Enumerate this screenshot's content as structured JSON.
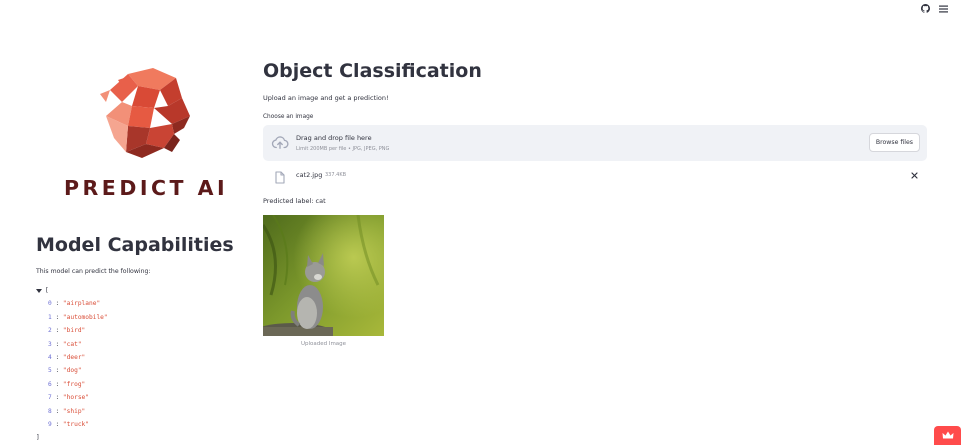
{
  "toolbar": {
    "github_icon": "github-icon",
    "menu_icon": "hamburger-menu-icon"
  },
  "sidebar": {
    "logo_icon": "polygonal-head-logo",
    "brand": "PREDICT AI",
    "title": "Model Capabilities",
    "description": "This model can predict the following:",
    "json_open": "[",
    "json_close": "]",
    "classes": [
      {
        "index": "0",
        "value": "\"airplane\""
      },
      {
        "index": "1",
        "value": "\"automobile\""
      },
      {
        "index": "2",
        "value": "\"bird\""
      },
      {
        "index": "3",
        "value": "\"cat\""
      },
      {
        "index": "4",
        "value": "\"deer\""
      },
      {
        "index": "5",
        "value": "\"dog\""
      },
      {
        "index": "6",
        "value": "\"frog\""
      },
      {
        "index": "7",
        "value": "\"horse\""
      },
      {
        "index": "8",
        "value": "\"ship\""
      },
      {
        "index": "9",
        "value": "\"truck\""
      }
    ]
  },
  "main": {
    "title": "Object Classification",
    "intro": "Upload an image and get a prediction!",
    "uploader_label": "Choose an image",
    "dropzone": {
      "icon": "cloud-upload-icon",
      "main_text": "Drag and drop file here",
      "sub_text": "Limit 200MB per file • JPG, JPEG, PNG",
      "button_label": "Browse files"
    },
    "file": {
      "icon": "file-icon",
      "name": "cat2.jpg",
      "size": "337.4KB",
      "remove_icon": "close-icon"
    },
    "prediction": "Predicted label: cat",
    "image_caption": "Uploaded Image"
  },
  "colors": {
    "accent": "#ff4b4b",
    "brand": "#5c1a1a",
    "logo": "#e8604a",
    "text": "#31333f",
    "dropzone_bg": "#f0f2f6"
  }
}
